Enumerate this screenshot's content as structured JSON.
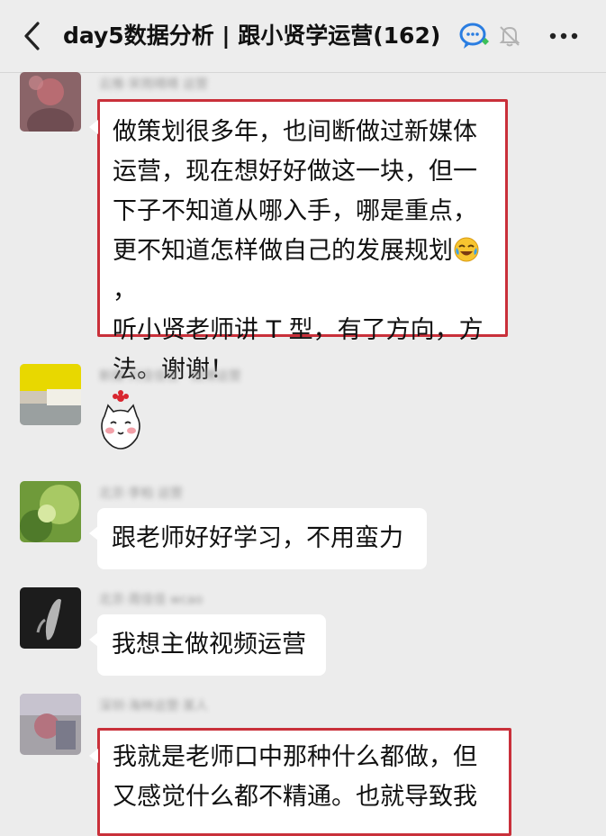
{
  "header": {
    "title": "day5数据分析 | 跟小贤学运营(162)",
    "icons": [
      "back-icon",
      "chat-bubble-icon",
      "mute-bell-icon",
      "more-icon"
    ]
  },
  "messages": [
    {
      "id": "m1",
      "name": "云推·宋雨晴晴 运营",
      "text_before": "做策划很多年，也间断做过新媒体\n运营，现在想好好做这一块，但一\n下子不知道从哪入手，哪是重点，\n更不知道怎样做自己的发展规划",
      "emoji": "laugh-cry-icon",
      "text_after": "，\n听小贤老师讲 T 型，有了方向，方\n法。谢谢！",
      "highlighted": true
    },
    {
      "id": "m2",
      "name": "新媒·刘佳佳佳 · 微博运营",
      "sticker": "cat-sticker-icon"
    },
    {
      "id": "m3",
      "name": "北京·李柏 运营",
      "text": "跟老师好好学习，不用蛮力"
    },
    {
      "id": "m4",
      "name": "北京·周佳佳 wcao",
      "text": "我想主做视频运营"
    },
    {
      "id": "m5",
      "name": "深圳·海林运营·某人",
      "text": "我就是老师口中那种什么都做，但\n又感觉什么都不精通。也就导致我",
      "highlighted": true
    }
  ],
  "colors": {
    "background": "#ececec",
    "highlight_border": "#c9303a",
    "bubble": "#ffffff"
  }
}
